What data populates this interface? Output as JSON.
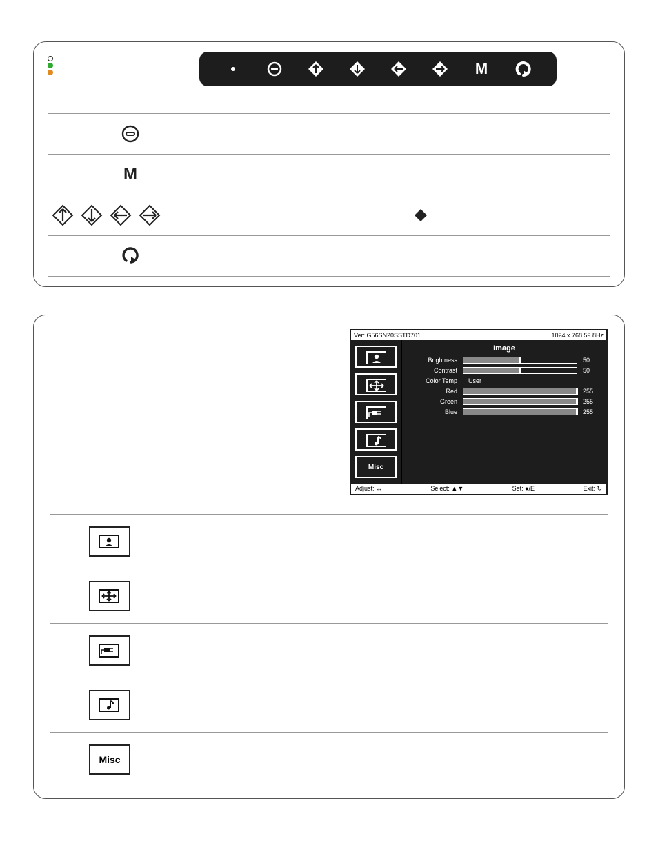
{
  "header_bar": {
    "buttons": [
      "dot",
      "power",
      "up",
      "down",
      "left",
      "right",
      "menu",
      "return"
    ]
  },
  "legend": {
    "rows": [
      {
        "icons": [
          "power"
        ]
      },
      {
        "icons": [
          "menu"
        ]
      },
      {
        "icons": [
          "up",
          "down",
          "left",
          "right"
        ],
        "right_icon": "diamond"
      },
      {
        "icons": [
          "return"
        ]
      }
    ]
  },
  "osd": {
    "version_label": "Ver: G56SN20SSTD701",
    "mode_label": "1024 x 768  59.8Hz",
    "title": "Image",
    "items": [
      {
        "label": "Brightness",
        "value": 50,
        "max": 100
      },
      {
        "label": "Contrast",
        "value": 50,
        "max": 100
      },
      {
        "label": "Color Temp",
        "text": "User"
      },
      {
        "label": "Red",
        "value": 255,
        "max": 255
      },
      {
        "label": "Green",
        "value": 255,
        "max": 255
      },
      {
        "label": "Blue",
        "value": 255,
        "max": 255
      }
    ],
    "footer": {
      "adjust": "Adjust: ↔",
      "select": "Select: ▲▼",
      "set": "Set: ●/E",
      "exit": "Exit: ↻"
    },
    "tabs": [
      "image",
      "geometry",
      "signal",
      "audio",
      "misc"
    ]
  },
  "categories": [
    {
      "id": "image"
    },
    {
      "id": "geometry"
    },
    {
      "id": "signal"
    },
    {
      "id": "audio"
    },
    {
      "id": "misc",
      "label": "Misc"
    }
  ]
}
